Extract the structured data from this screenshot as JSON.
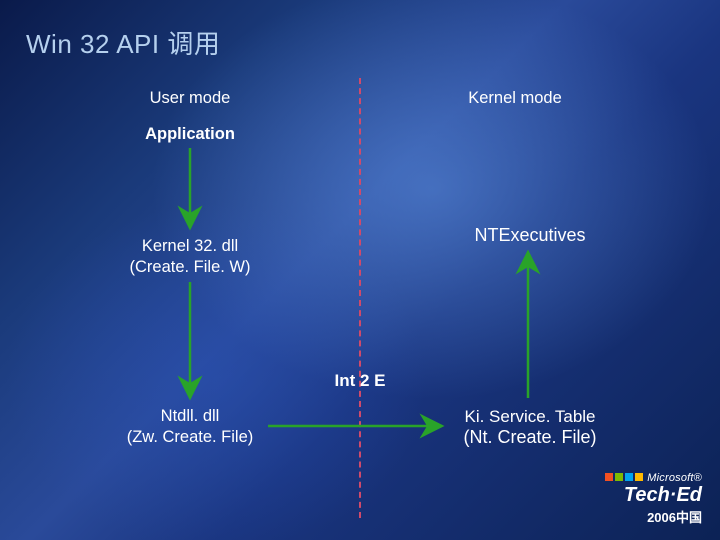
{
  "title": "Win 32 API 调用",
  "labels": {
    "user_mode": "User mode",
    "kernel_mode": "Kernel mode",
    "application": "Application",
    "kernel32": "Kernel 32. dll\n(Create. File. W)",
    "ntexecutives": "NTExecutives",
    "int2e": "Int 2 E",
    "ntdll": "Ntdll. dll\n(Zw. Create. File)",
    "kiservice_l1": "Ki. Service. Table",
    "kiservice_l2": "(Nt. Create. File)"
  },
  "logo": {
    "brand": "Microsoft",
    "product": "Tech·Ed",
    "sub": "2006中国"
  },
  "colors": {
    "title": "#b5d0ee",
    "divider": "#d04a6a",
    "arrow": "#29a329"
  }
}
